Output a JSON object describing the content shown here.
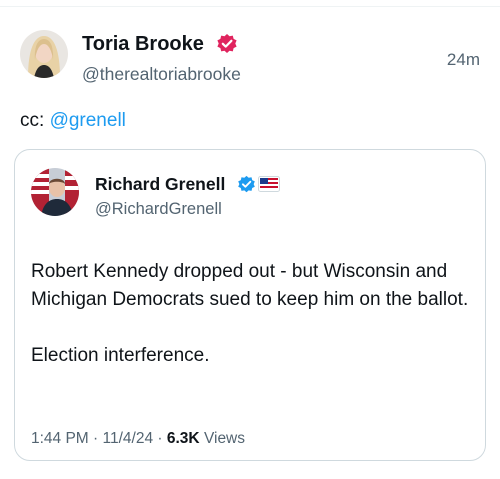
{
  "post": {
    "author_name": "Toria Brooke",
    "author_handle": "@therealtoriabrooke",
    "timestamp": "24m",
    "text_prefix": "cc: ",
    "mention": "@grenell",
    "verified_badge_color": "#e0245e"
  },
  "quoted": {
    "author_name": "Richard Grenell",
    "author_handle": "@RichardGrenell",
    "verified_badge_color": "#1d9bf0",
    "body_line_1": "Robert Kennedy dropped out - but Wisconsin and Michigan Democrats sued to keep him on the ballot.",
    "body_line_2": "Election interference.",
    "time": "1:44 PM",
    "date": "11/4/24",
    "views_count": "6.3K",
    "views_label": "Views",
    "separator": " · "
  },
  "icons": {
    "post_verified": "verified-badge-icon",
    "quoted_verified": "verified-badge-icon",
    "quoted_affiliate": "affiliate-flag-icon"
  }
}
